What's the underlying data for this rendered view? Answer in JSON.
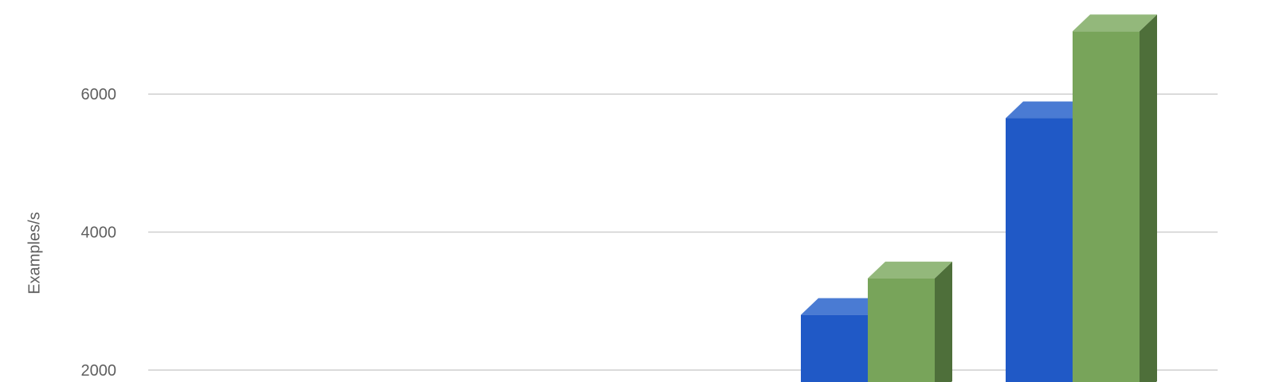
{
  "chart_data": {
    "type": "bar",
    "ylabel": "Examples/s",
    "y_ticks": [
      2000,
      4000,
      6000
    ],
    "grid": true,
    "style": "3d",
    "series": [
      {
        "points": [
          {
            "slot": 4,
            "value": 2800
          },
          {
            "slot": 5,
            "value": 5650
          }
        ],
        "color": "#2059c6",
        "top_color": "#4a7bd3",
        "side_color": "#1a4aa8"
      },
      {
        "points": [
          {
            "slot": 4,
            "value": 3330
          },
          {
            "slot": 5,
            "value": 6910
          }
        ],
        "color": "#78a45a",
        "top_color": "#93b87b",
        "side_color": "#4e6f3a"
      }
    ]
  }
}
